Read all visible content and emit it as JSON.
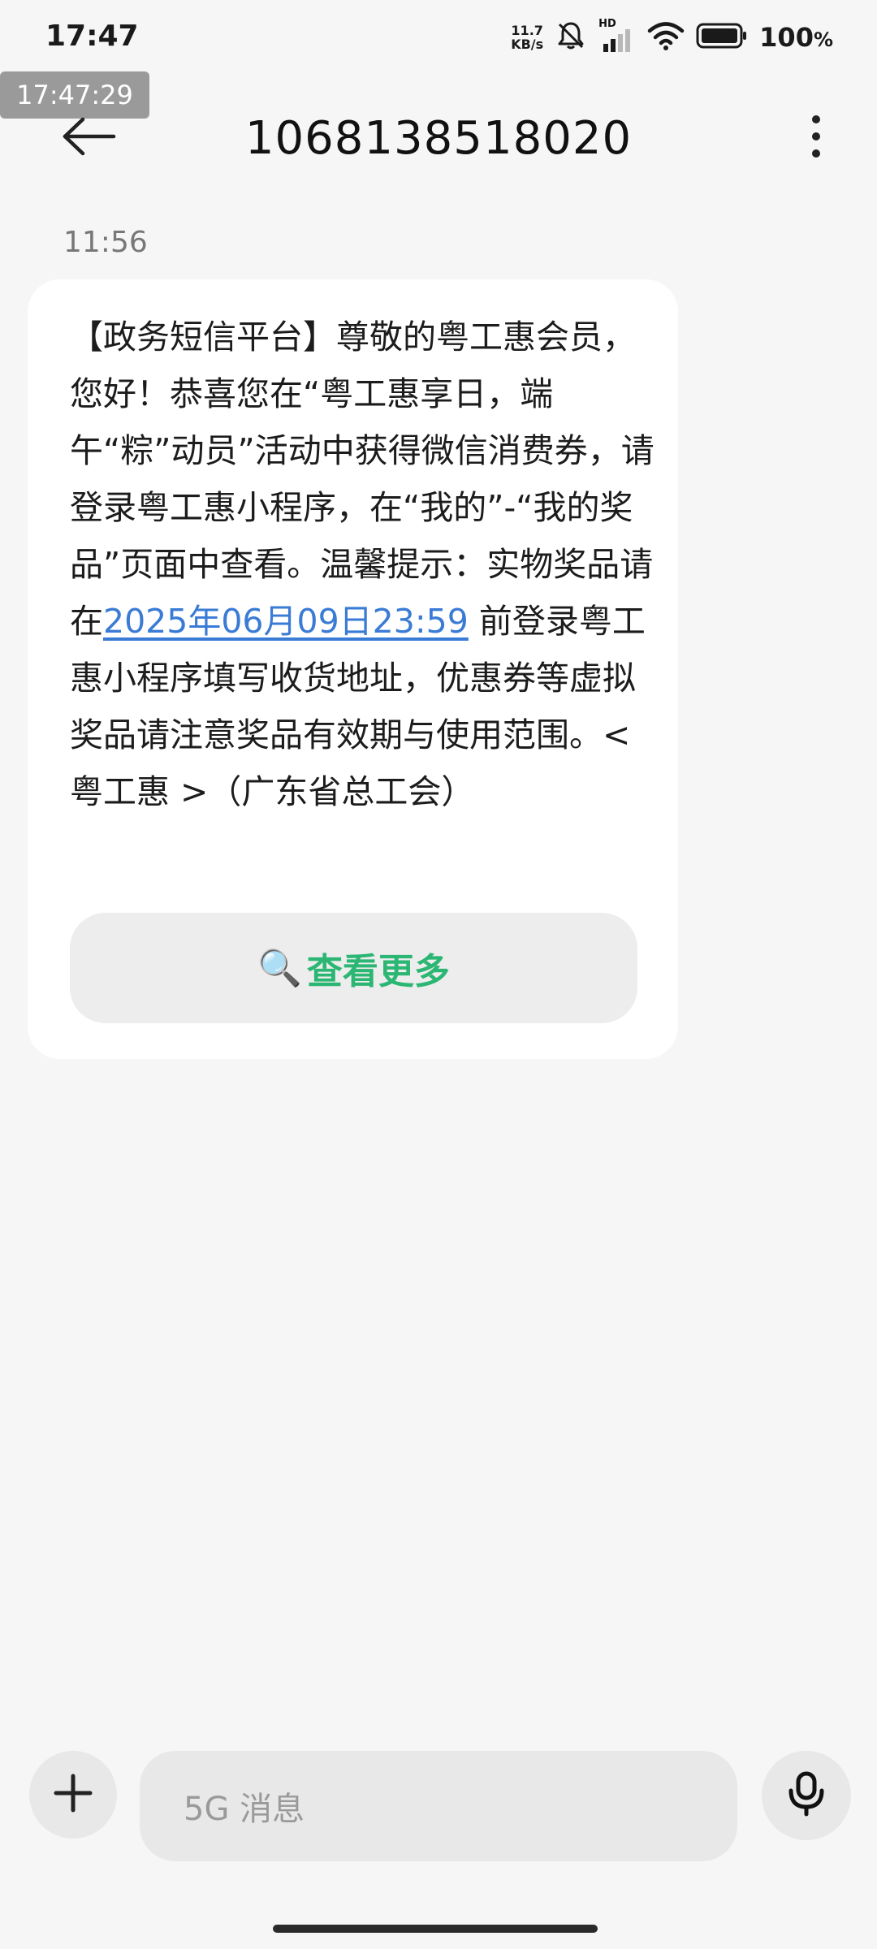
{
  "status_bar": {
    "time": "17:47",
    "net_speed_value": "11.7",
    "net_speed_unit": "KB/s",
    "signal_label": "HD",
    "battery_value": "100",
    "battery_unit": "%"
  },
  "overlay": {
    "timestamp": "17:47:29"
  },
  "header": {
    "title": "1068138518020",
    "back_icon": "back-arrow-icon",
    "more_icon": "more-vertical-icon"
  },
  "message": {
    "time": "11:56",
    "text_before_link": "【政务短信平台】尊敬的粤工惠会员，您好！恭喜您在“粤工惠享日，端午“粽”动员”活动中获得微信消费券，请登录粤工惠小程序，在“我的”-“我的奖品”页面中查看。温馨提示：实物奖品请在",
    "link_text": "2025年06月09日23:59",
    "text_after_link": " 前登录粤工惠小程序填写收货地址，优惠券等虚拟奖品请注意奖品有效期与使用范围。< 粤工惠 >（广东省总工会）",
    "button_icon": "🔍",
    "button_label": "查看更多",
    "link_color": "#3a7bd5",
    "button_color": "#2bb673"
  },
  "composer": {
    "placeholder": "5G 消息",
    "add_icon": "plus-icon",
    "mic_icon": "microphone-icon"
  }
}
